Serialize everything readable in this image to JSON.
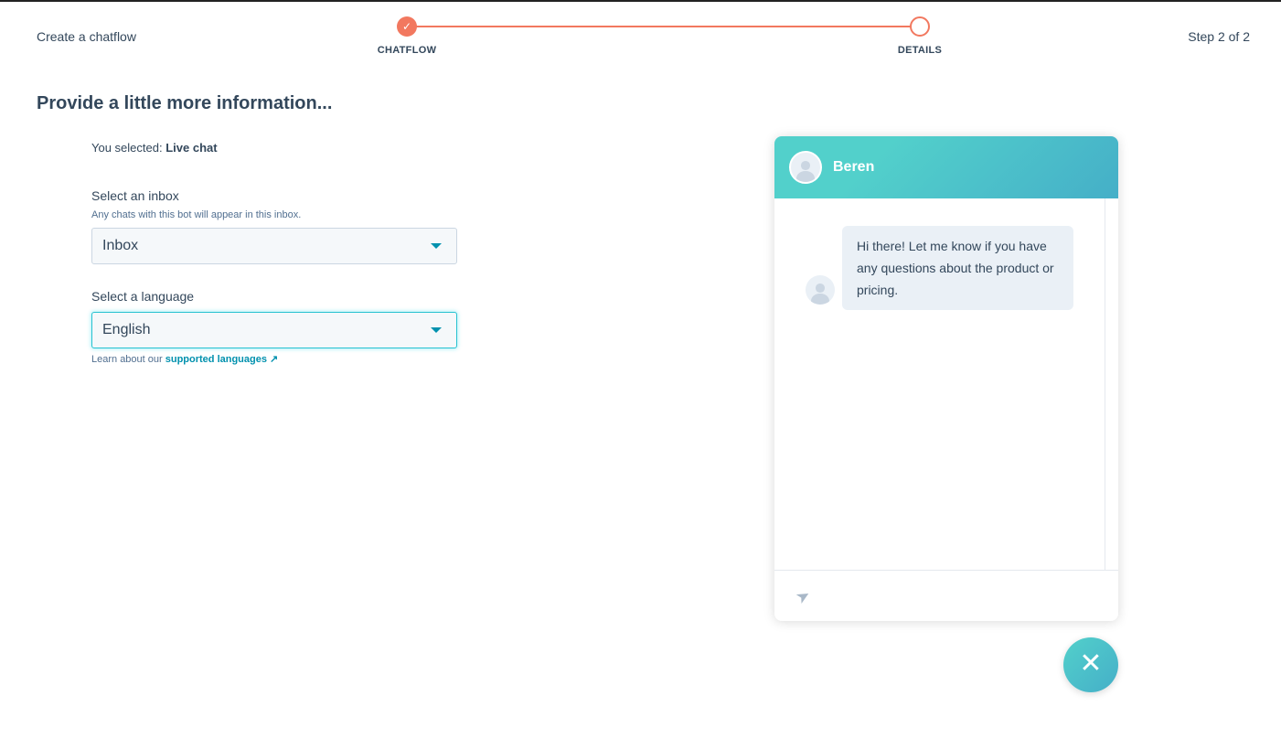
{
  "header": {
    "title": "Create a chatflow",
    "step_count": "Step 2 of 2",
    "steps": [
      {
        "label": "CHATFLOW",
        "state": "complete"
      },
      {
        "label": "DETAILS",
        "state": "current"
      }
    ]
  },
  "page": {
    "heading": "Provide a little more information..."
  },
  "form": {
    "selected_prefix": "You selected:",
    "selected_value": "Live chat",
    "inbox_label": "Select an inbox",
    "inbox_hint": "Any chats with this bot will appear in this inbox.",
    "inbox_value": "Inbox",
    "language_label": "Select a language",
    "language_value": "English",
    "learn_prefix": "Learn about our",
    "learn_link": "supported languages"
  },
  "preview": {
    "name": "Beren",
    "message": "Hi there! Let me know if you have any questions about the product or pricing."
  },
  "colors": {
    "accent": "#f2785f",
    "teal": "#52d0cb",
    "link": "#0091ae"
  }
}
